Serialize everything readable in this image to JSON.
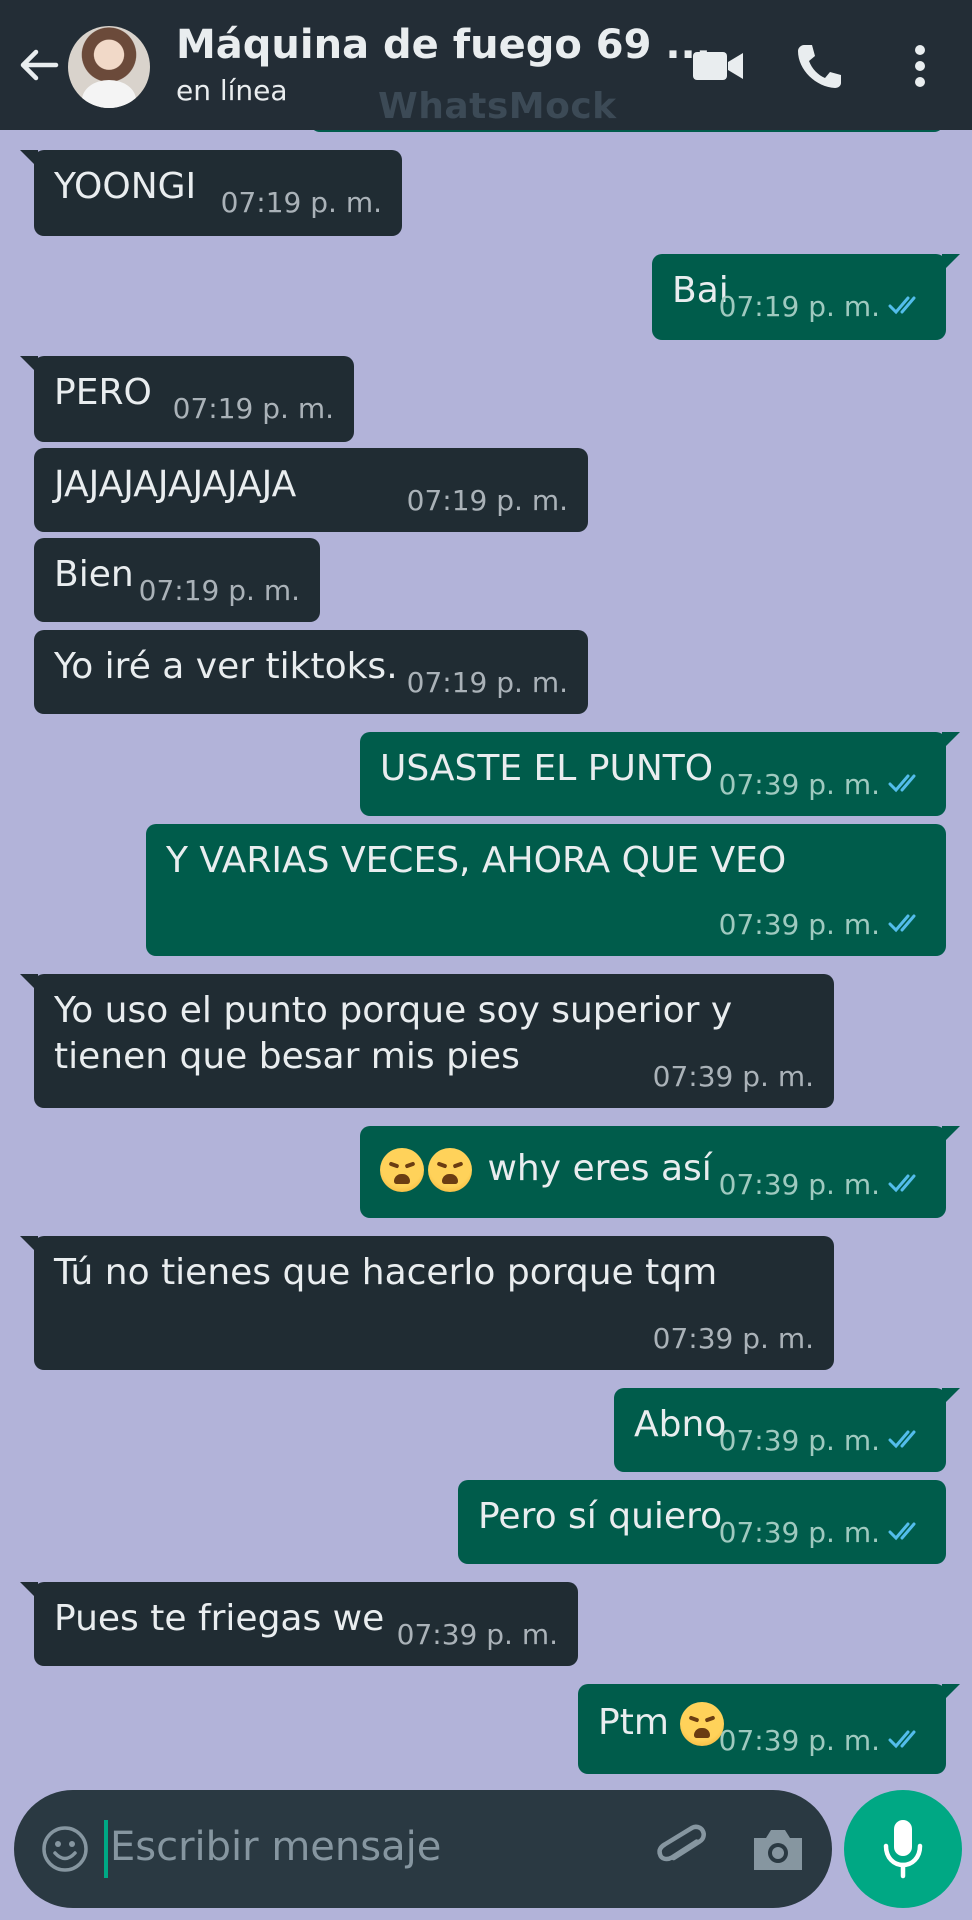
{
  "header": {
    "title": "Máquina de fuego 69 ...",
    "status": "en línea",
    "watermark": "WhatsMock"
  },
  "messages": [
    {
      "dir": "in",
      "text": "YOONGI",
      "time": "07:19 p. m."
    },
    {
      "dir": "out",
      "text": "Bai",
      "time": "07:19 p. m.",
      "read": true
    },
    {
      "dir": "in",
      "text": "PERO",
      "time": "07:19 p. m."
    },
    {
      "dir": "in",
      "text": "JAJAJAJAJAJAJA",
      "time": "07:19 p. m."
    },
    {
      "dir": "in",
      "text": "Bien",
      "time": "07:19 p. m."
    },
    {
      "dir": "in",
      "text": "Yo iré a ver tiktoks.",
      "time": "07:19 p. m."
    },
    {
      "dir": "out",
      "text": "USASTE EL PUNTO",
      "time": "07:39 p. m.",
      "read": true
    },
    {
      "dir": "out",
      "text": "Y VARIAS VECES, AHORA QUE VEO",
      "time": "07:39 p. m.",
      "read": true
    },
    {
      "dir": "in",
      "text": "Yo uso el punto porque soy superior y\ntienen que besar mis pies",
      "time": "07:39 p. m."
    },
    {
      "dir": "out",
      "text": "why eres así",
      "emoji_prefix": [
        "weary-face",
        "weary-face"
      ],
      "time": "07:39 p. m.",
      "read": true
    },
    {
      "dir": "in",
      "text": "Tú no tienes que hacerlo porque tqm",
      "time": "07:39 p. m."
    },
    {
      "dir": "out",
      "text": "Abno",
      "time": "07:39 p. m.",
      "read": true
    },
    {
      "dir": "out",
      "text": "Pero sí quiero",
      "time": "07:39 p. m.",
      "read": true
    },
    {
      "dir": "in",
      "text": "Pues te friegas we",
      "time": "07:39 p. m."
    },
    {
      "dir": "out",
      "text": "Ptm",
      "emoji_suffix": [
        "weary-face"
      ],
      "time": "07:39 p. m.",
      "read": true
    }
  ],
  "composer": {
    "placeholder": "Escribir mensaje",
    "icons": [
      "emoji-icon",
      "attach-icon",
      "camera-icon",
      "mic-icon"
    ]
  },
  "colors": {
    "background": "#b2b3d9",
    "header": "#232d36",
    "incoming": "#202c33",
    "outgoing": "#005c4b",
    "accent": "#00a884",
    "read_ticks": "#53bdeb"
  }
}
